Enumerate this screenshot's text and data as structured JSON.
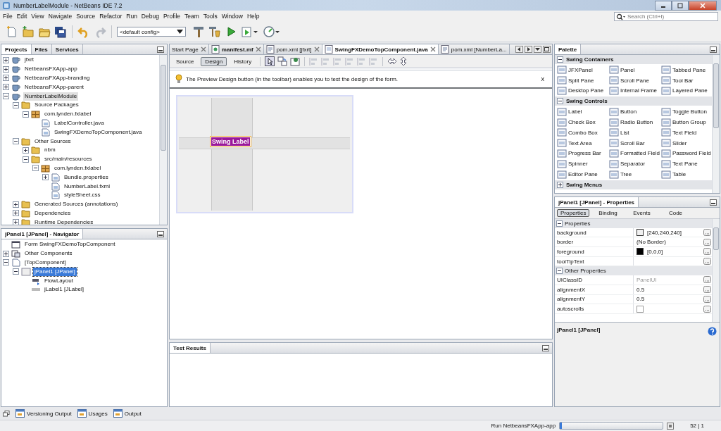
{
  "window": {
    "title": "NumberLabelModule - NetBeans IDE 7.2"
  },
  "menu": [
    "File",
    "Edit",
    "View",
    "Navigate",
    "Source",
    "Refactor",
    "Run",
    "Debug",
    "Profile",
    "Team",
    "Tools",
    "Window",
    "Help"
  ],
  "search": {
    "placeholder": "Search (Ctrl+I)"
  },
  "toolbar": {
    "config": "<default config>"
  },
  "projects": {
    "tabs": [
      {
        "label": "Projects",
        "selected": true
      },
      {
        "label": "Files",
        "selected": false
      },
      {
        "label": "Services",
        "selected": false
      }
    ],
    "tree": [
      {
        "label": "jfxrt",
        "kind": "project",
        "expanded": false,
        "selected": false
      },
      {
        "label": "NetbeansFXApp-app",
        "kind": "project",
        "expanded": false,
        "selected": false
      },
      {
        "label": "NetbeansFXApp-branding",
        "kind": "project",
        "expanded": false,
        "selected": false
      },
      {
        "label": "NetbeansFXApp-parent",
        "kind": "project",
        "expanded": false,
        "selected": false
      },
      {
        "label": "NumberLabelModule",
        "kind": "project",
        "expanded": true,
        "selected": true,
        "children": [
          {
            "label": "Source Packages",
            "kind": "folder",
            "expanded": true,
            "selected": false,
            "children": [
              {
                "label": "com.lynden.fxlabel",
                "kind": "package",
                "expanded": true,
                "selected": false,
                "children": [
                  {
                    "label": "LabelController.java",
                    "kind": "file",
                    "selected": false
                  },
                  {
                    "label": "SwingFXDemoTopComponent.java",
                    "kind": "file",
                    "selected": false
                  }
                ]
              }
            ]
          },
          {
            "label": "Other Sources",
            "kind": "folder",
            "expanded": true,
            "selected": false,
            "children": [
              {
                "label": "nbm",
                "kind": "folder",
                "expanded": false,
                "selected": false
              },
              {
                "label": "src/main/resources",
                "kind": "folder",
                "expanded": true,
                "selected": false,
                "children": [
                  {
                    "label": "com.lynden.fxlabel",
                    "kind": "package",
                    "expanded": true,
                    "selected": false,
                    "children": [
                      {
                        "label": "Bundle.properties",
                        "kind": "file",
                        "expanded": false,
                        "selected": false
                      },
                      {
                        "label": "NumberLabel.fxml",
                        "kind": "file",
                        "selected": false
                      },
                      {
                        "label": "styleSheet.css",
                        "kind": "file",
                        "selected": false
                      }
                    ]
                  }
                ]
              }
            ]
          },
          {
            "label": "Generated Sources (annotations)",
            "kind": "folder",
            "expanded": false,
            "selected": false
          },
          {
            "label": "Dependencies",
            "kind": "folder",
            "expanded": false,
            "selected": false
          },
          {
            "label": "Runtime Dependencies",
            "kind": "folder",
            "expanded": false,
            "selected": false
          }
        ]
      }
    ]
  },
  "navigator": {
    "title": "jPanel1 [JPanel] - Navigator",
    "tree": [
      {
        "label": "Form SwingFXDemoTopComponent",
        "kind": "form",
        "selected": false
      },
      {
        "label": "Other Components",
        "kind": "components",
        "expanded": false,
        "selected": false
      },
      {
        "label": "[TopComponent]",
        "kind": "file",
        "expanded": true,
        "selected": false,
        "children": [
          {
            "label": "jPanel1 [JPanel]",
            "kind": "panel",
            "expanded": true,
            "selected": true,
            "children": [
              {
                "label": "FlowLayout",
                "kind": "layout",
                "selected": false
              },
              {
                "label": "jLabel1 [JLabel]",
                "kind": "label",
                "selected": false
              }
            ]
          }
        ]
      }
    ]
  },
  "editor": {
    "tabs": [
      {
        "label": "Start Page",
        "kind": "page",
        "bold": false,
        "selected": false
      },
      {
        "label": "manifest.mf",
        "kind": "manifest",
        "bold": true,
        "selected": false
      },
      {
        "label": "pom.xml [jfxrt]",
        "kind": "xml",
        "bold": false,
        "selected": false
      },
      {
        "label": "SwingFXDemoTopComponent.java",
        "kind": "form",
        "bold": true,
        "selected": true
      },
      {
        "label": "pom.xml [NumberLa...",
        "kind": "xml",
        "bold": false,
        "selected": false
      }
    ],
    "views": [
      {
        "label": "Source",
        "selected": false
      },
      {
        "label": "Design",
        "selected": true
      },
      {
        "label": "History",
        "selected": false
      }
    ],
    "hint": "The Preview Design button (in the toolbar) enables you to test the design of the form.",
    "hint_close": "x",
    "form_label": "Swing Label"
  },
  "test_results": {
    "title": "Test Results"
  },
  "palette": {
    "title": "Palette",
    "categories": [
      {
        "title": "Swing Containers",
        "expanded": true,
        "items": [
          "JFXPanel",
          "Panel",
          "Tabbed Pane",
          "Split Pane",
          "Scroll Pane",
          "Tool Bar",
          "Desktop Pane",
          "Internal Frame",
          "Layered Pane"
        ]
      },
      {
        "title": "Swing Controls",
        "expanded": true,
        "items": [
          "Label",
          "Button",
          "Toggle Button",
          "Check Box",
          "Radio Button",
          "Button Group",
          "Combo Box",
          "List",
          "Text Field",
          "Text Area",
          "Scroll Bar",
          "Slider",
          "Progress Bar",
          "Formatted Field",
          "Password Field",
          "Spinner",
          "Separator",
          "Text Pane",
          "Editor Pane",
          "Tree",
          "Table"
        ]
      },
      {
        "title": "Swing Menus",
        "expanded": false
      }
    ]
  },
  "properties": {
    "title": "jPanel1 [JPanel] - Properties",
    "tabs": [
      {
        "label": "Properties",
        "selected": true
      },
      {
        "label": "Binding",
        "selected": false
      },
      {
        "label": "Events",
        "selected": false
      },
      {
        "label": "Code",
        "selected": false
      }
    ],
    "sections": [
      {
        "title": "Properties",
        "rows": [
          {
            "name": "background",
            "kind": "color",
            "value": "[240,240,240]",
            "color": "#f0f0f0"
          },
          {
            "name": "border",
            "kind": "text",
            "value": "(No Border)"
          },
          {
            "name": "foreground",
            "kind": "color",
            "value": "[0,0,0]",
            "color": "#000000"
          },
          {
            "name": "toolTipText",
            "kind": "text"
          }
        ]
      },
      {
        "title": "Other Properties",
        "rows": [
          {
            "name": "UIClassID",
            "kind": "text",
            "value": "PanelUI",
            "disabled": true
          },
          {
            "name": "alignmentX",
            "kind": "text",
            "value": "0.5"
          },
          {
            "name": "alignmentY",
            "kind": "text",
            "value": "0.5"
          },
          {
            "name": "autoscrolls",
            "kind": "checkbox",
            "checked": false
          }
        ]
      }
    ],
    "description": "jPanel1 [JPanel]"
  },
  "bottom_tabs": [
    "Versioning Output",
    "Usages",
    "Output"
  ],
  "status": {
    "task": "Run NetbeansFXApp-app",
    "level": 0.02,
    "position": "52 | 1"
  }
}
